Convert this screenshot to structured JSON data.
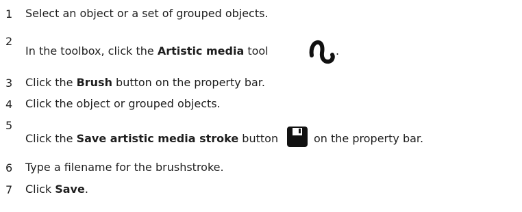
{
  "steps": [
    {
      "num": "1",
      "parts": [
        "Select an object or a set of grouped objects."
      ]
    },
    {
      "num": "2",
      "pre": "In the toolbox, click the ",
      "bold": "Artistic media",
      "post": " tool",
      "tail": ".",
      "icon": "artistic-media-icon"
    },
    {
      "num": "3",
      "pre": "Click the ",
      "bold": "Brush",
      "post": " button on the property bar."
    },
    {
      "num": "4",
      "parts": [
        "Click the object or grouped objects."
      ]
    },
    {
      "num": "5",
      "pre": "Click the ",
      "bold": "Save artistic media stroke",
      "post": " button",
      "tail": "on the property bar.",
      "icon": "save-stroke-icon"
    },
    {
      "num": "6",
      "parts": [
        "Type a filename for the brushstroke."
      ]
    },
    {
      "num": "7",
      "pre": "Click ",
      "bold": "Save",
      "post": "."
    }
  ]
}
